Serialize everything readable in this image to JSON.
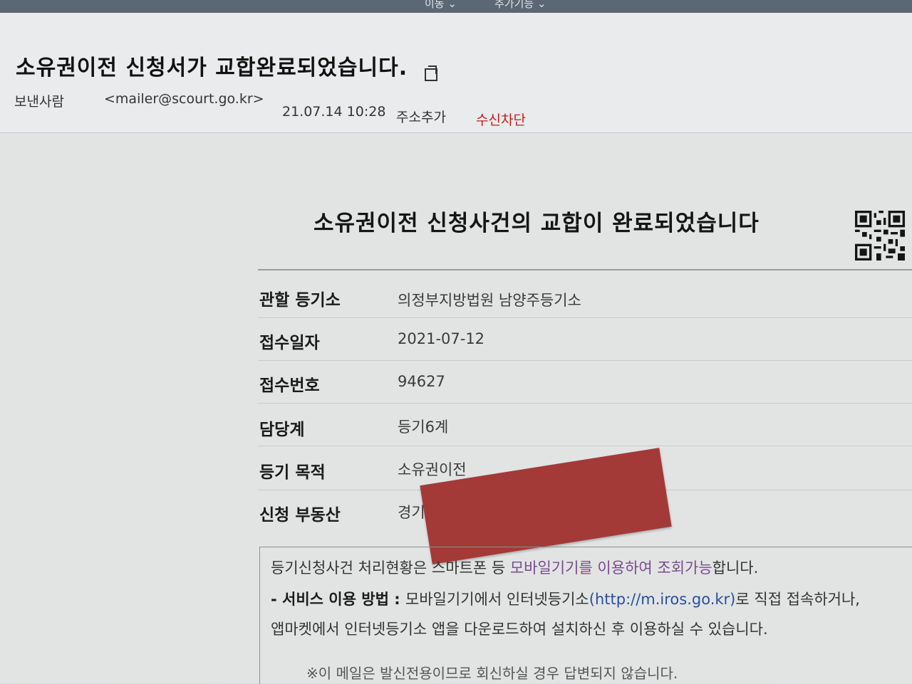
{
  "top_menu": {
    "item1": "이동 ⌄",
    "item2": "추가기능 ⌄"
  },
  "email": {
    "subject": "소유권이전 신청서가 교합완료되었습니다.",
    "sender_label": "보낸사람",
    "sender": "<mailer@scourt.go.kr>",
    "date": "21.07.14 10:28",
    "add_contact": "주소추가",
    "block": "수신차단"
  },
  "notice": {
    "title": "소유권이전 신청사건의 교합이 완료되었습니다",
    "rows": [
      {
        "label": "관할 등기소",
        "value": "의정부지방법원 남양주등기소"
      },
      {
        "label": "접수일자",
        "value": "2021-07-12"
      },
      {
        "label": "접수번호",
        "value": "94627"
      },
      {
        "label": "담당계",
        "value": "등기6계"
      },
      {
        "label": "등기 목적",
        "value": "소유권이전"
      },
      {
        "label": "신청 부동산",
        "value": "경기"
      }
    ],
    "info": {
      "line1_a": "등기신청사건 처리현황은 스마트폰 등 ",
      "line1_b": "모바일기기를 이용하여 조회가능",
      "line1_c": "합니다.",
      "line2_bold": "- 서비스 이용 방법 : ",
      "line2_a": "모바일기기에서 인터넷등기소",
      "line2_link": "(http://m.iros.go.kr)",
      "line2_b": "로 직접 접속하거나,",
      "line3": "앱마켓에서 인터넷등기소 앱을 다운로드하여 설치하신 후 이용하실 수 있습니다.",
      "line4": "※이 메일은 발신전용이므로 회신하실 경우 답변되지 않습니다."
    }
  },
  "colors": {
    "block": "#c21d1d",
    "link": "#2a4f9a",
    "highlight": "#7b4a8e",
    "redaction": "#a33a38"
  }
}
